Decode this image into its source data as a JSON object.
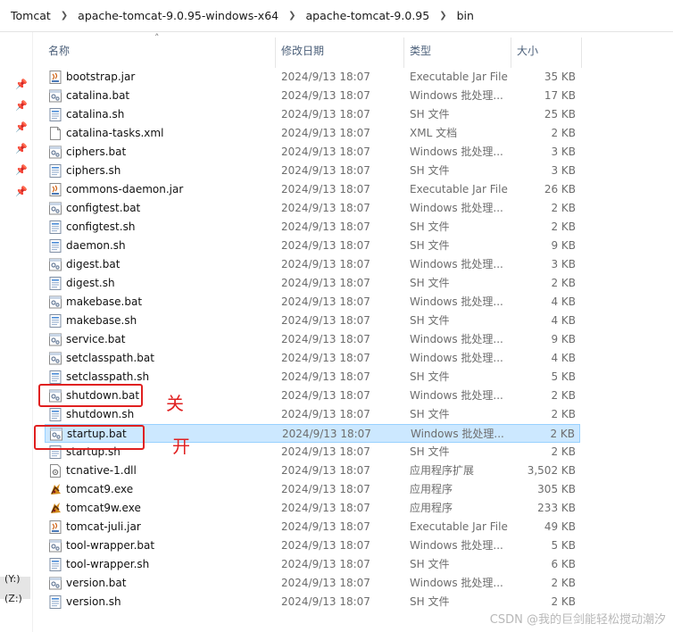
{
  "breadcrumb": [
    "Tomcat",
    "apache-tomcat-9.0.95-windows-x64",
    "apache-tomcat-9.0.95",
    "bin"
  ],
  "columns": {
    "name": "名称",
    "date": "修改日期",
    "type": "类型",
    "size": "大小"
  },
  "nav": {
    "drives": [
      "(Y:)",
      "(Z:)"
    ]
  },
  "files": [
    {
      "name": "bootstrap.jar",
      "date": "2024/9/13 18:07",
      "type": "Executable Jar File",
      "size": "35 KB",
      "icon": "jar-icon"
    },
    {
      "name": "catalina.bat",
      "date": "2024/9/13 18:07",
      "type": "Windows 批处理...",
      "size": "17 KB",
      "icon": "bat-icon"
    },
    {
      "name": "catalina.sh",
      "date": "2024/9/13 18:07",
      "type": "SH 文件",
      "size": "25 KB",
      "icon": "sh-icon"
    },
    {
      "name": "catalina-tasks.xml",
      "date": "2024/9/13 18:07",
      "type": "XML 文档",
      "size": "2 KB",
      "icon": "xml-icon"
    },
    {
      "name": "ciphers.bat",
      "date": "2024/9/13 18:07",
      "type": "Windows 批处理...",
      "size": "3 KB",
      "icon": "bat-icon"
    },
    {
      "name": "ciphers.sh",
      "date": "2024/9/13 18:07",
      "type": "SH 文件",
      "size": "3 KB",
      "icon": "sh-icon"
    },
    {
      "name": "commons-daemon.jar",
      "date": "2024/9/13 18:07",
      "type": "Executable Jar File",
      "size": "26 KB",
      "icon": "jar-icon"
    },
    {
      "name": "configtest.bat",
      "date": "2024/9/13 18:07",
      "type": "Windows 批处理...",
      "size": "2 KB",
      "icon": "bat-icon"
    },
    {
      "name": "configtest.sh",
      "date": "2024/9/13 18:07",
      "type": "SH 文件",
      "size": "2 KB",
      "icon": "sh-icon"
    },
    {
      "name": "daemon.sh",
      "date": "2024/9/13 18:07",
      "type": "SH 文件",
      "size": "9 KB",
      "icon": "sh-icon"
    },
    {
      "name": "digest.bat",
      "date": "2024/9/13 18:07",
      "type": "Windows 批处理...",
      "size": "3 KB",
      "icon": "bat-icon"
    },
    {
      "name": "digest.sh",
      "date": "2024/9/13 18:07",
      "type": "SH 文件",
      "size": "2 KB",
      "icon": "sh-icon"
    },
    {
      "name": "makebase.bat",
      "date": "2024/9/13 18:07",
      "type": "Windows 批处理...",
      "size": "4 KB",
      "icon": "bat-icon"
    },
    {
      "name": "makebase.sh",
      "date": "2024/9/13 18:07",
      "type": "SH 文件",
      "size": "4 KB",
      "icon": "sh-icon"
    },
    {
      "name": "service.bat",
      "date": "2024/9/13 18:07",
      "type": "Windows 批处理...",
      "size": "9 KB",
      "icon": "bat-icon"
    },
    {
      "name": "setclasspath.bat",
      "date": "2024/9/13 18:07",
      "type": "Windows 批处理...",
      "size": "4 KB",
      "icon": "bat-icon"
    },
    {
      "name": "setclasspath.sh",
      "date": "2024/9/13 18:07",
      "type": "SH 文件",
      "size": "5 KB",
      "icon": "sh-icon"
    },
    {
      "name": "shutdown.bat",
      "date": "2024/9/13 18:07",
      "type": "Windows 批处理...",
      "size": "2 KB",
      "icon": "bat-icon"
    },
    {
      "name": "shutdown.sh",
      "date": "2024/9/13 18:07",
      "type": "SH 文件",
      "size": "2 KB",
      "icon": "sh-icon"
    },
    {
      "name": "startup.bat",
      "date": "2024/9/13 18:07",
      "type": "Windows 批处理...",
      "size": "2 KB",
      "icon": "bat-icon",
      "selected": true
    },
    {
      "name": "startup.sh",
      "date": "2024/9/13 18:07",
      "type": "SH 文件",
      "size": "2 KB",
      "icon": "sh-icon"
    },
    {
      "name": "tcnative-1.dll",
      "date": "2024/9/13 18:07",
      "type": "应用程序扩展",
      "size": "3,502 KB",
      "icon": "dll-icon"
    },
    {
      "name": "tomcat9.exe",
      "date": "2024/9/13 18:07",
      "type": "应用程序",
      "size": "305 KB",
      "icon": "tomcat-exe-icon"
    },
    {
      "name": "tomcat9w.exe",
      "date": "2024/9/13 18:07",
      "type": "应用程序",
      "size": "233 KB",
      "icon": "tomcat-exe-icon"
    },
    {
      "name": "tomcat-juli.jar",
      "date": "2024/9/13 18:07",
      "type": "Executable Jar File",
      "size": "49 KB",
      "icon": "jar-icon"
    },
    {
      "name": "tool-wrapper.bat",
      "date": "2024/9/13 18:07",
      "type": "Windows 批处理...",
      "size": "5 KB",
      "icon": "bat-icon"
    },
    {
      "name": "tool-wrapper.sh",
      "date": "2024/9/13 18:07",
      "type": "SH 文件",
      "size": "6 KB",
      "icon": "sh-icon"
    },
    {
      "name": "version.bat",
      "date": "2024/9/13 18:07",
      "type": "Windows 批处理...",
      "size": "2 KB",
      "icon": "bat-icon"
    },
    {
      "name": "version.sh",
      "date": "2024/9/13 18:07",
      "type": "SH 文件",
      "size": "2 KB",
      "icon": "sh-icon"
    }
  ],
  "annotations": {
    "shutdown_label": "关",
    "startup_label": "开",
    "color": "#e02020"
  },
  "watermark": "CSDN @我的巨剑能轻松搅动潮汐"
}
